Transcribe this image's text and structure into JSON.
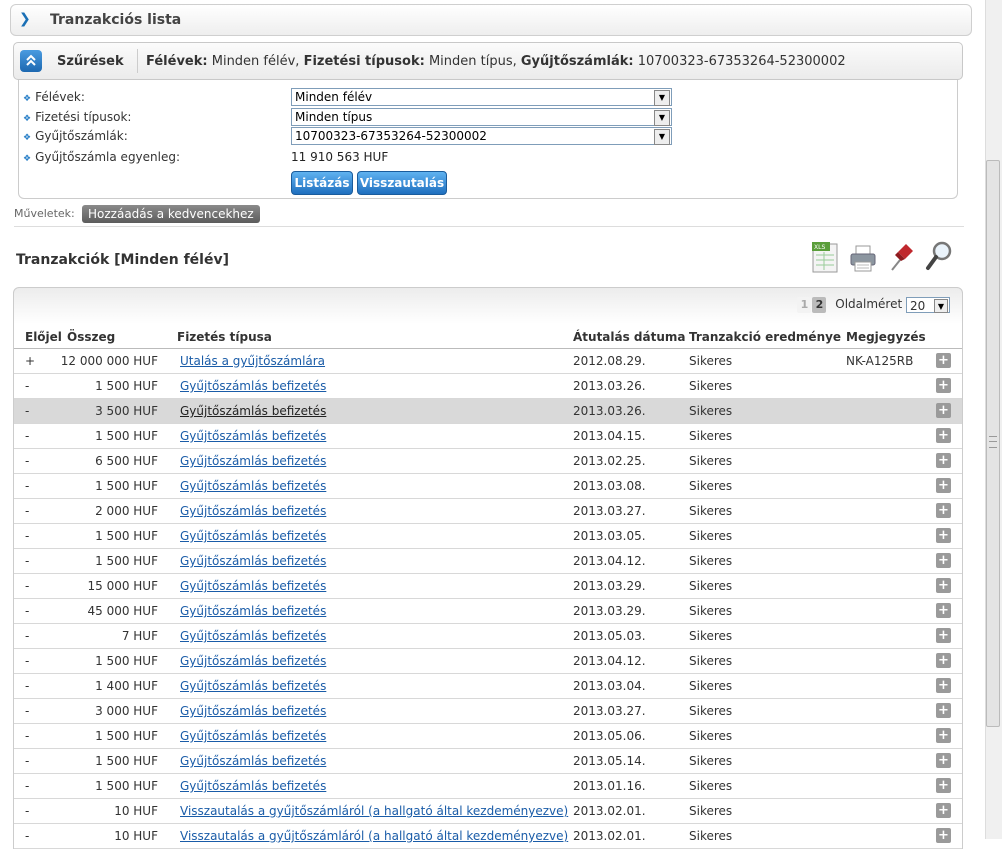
{
  "page_title": "Tranzakciós lista",
  "filters": {
    "toggle_label": "Szűrések",
    "summary": [
      {
        "key": "Félévek:",
        "value": "Minden félév,"
      },
      {
        "key": "Fizetési típusok:",
        "value": "Minden típus,"
      },
      {
        "key": "Gyűjtőszámlák:",
        "value": "10700323-67353264-52300002"
      }
    ],
    "fields": {
      "semesters_label": "Félévek:",
      "semesters_value": "Minden félév",
      "payment_types_label": "Fizetési típusok:",
      "payment_types_value": "Minden típus",
      "accounts_label": "Gyűjtőszámlák:",
      "accounts_value": "10700323-67353264-52300002",
      "balance_label": "Gyűjtőszámla egyenleg:",
      "balance_value": "11 910 563 HUF"
    },
    "list_button": "Listázás",
    "refund_button": "Visszautalás"
  },
  "operations": {
    "label": "Műveletek:",
    "add_favorite": "Hozzáadás a kedvencekhez"
  },
  "section_title": "Tranzakciók [Minden félév]",
  "toolbar_icons": [
    "excel-export-icon",
    "print-icon",
    "pin-icon",
    "search-icon"
  ],
  "pager": {
    "pages": [
      "1",
      "2"
    ],
    "current_page": "2",
    "page_size_label": "Oldalméret",
    "page_size": "20"
  },
  "table": {
    "columns": [
      "Előjel",
      "Összeg",
      "Fizetés típusa",
      "Átutalás dátuma",
      "Tranzakció eredménye",
      "Megjegyzés"
    ],
    "rows": [
      {
        "sign": "+",
        "amount": "12 000 000 HUF",
        "type": "Utalás a gyűjtőszámlára",
        "date": "2012.08.29.",
        "result": "Sikeres",
        "note": "NK-A125RB"
      },
      {
        "sign": "-",
        "amount": "1 500 HUF",
        "type": "Gyűjtőszámlás befizetés",
        "date": "2013.03.26.",
        "result": "Sikeres",
        "note": ""
      },
      {
        "sign": "-",
        "amount": "3 500 HUF",
        "type": "Gyűjtőszámlás befizetés",
        "date": "2013.03.26.",
        "result": "Sikeres",
        "note": "",
        "highlighted": true
      },
      {
        "sign": "-",
        "amount": "1 500 HUF",
        "type": "Gyűjtőszámlás befizetés",
        "date": "2013.04.15.",
        "result": "Sikeres",
        "note": ""
      },
      {
        "sign": "-",
        "amount": "6 500 HUF",
        "type": "Gyűjtőszámlás befizetés",
        "date": "2013.02.25.",
        "result": "Sikeres",
        "note": ""
      },
      {
        "sign": "-",
        "amount": "1 500 HUF",
        "type": "Gyűjtőszámlás befizetés",
        "date": "2013.03.08.",
        "result": "Sikeres",
        "note": ""
      },
      {
        "sign": "-",
        "amount": "2 000 HUF",
        "type": "Gyűjtőszámlás befizetés",
        "date": "2013.03.27.",
        "result": "Sikeres",
        "note": ""
      },
      {
        "sign": "-",
        "amount": "1 500 HUF",
        "type": "Gyűjtőszámlás befizetés",
        "date": "2013.03.05.",
        "result": "Sikeres",
        "note": ""
      },
      {
        "sign": "-",
        "amount": "1 500 HUF",
        "type": "Gyűjtőszámlás befizetés",
        "date": "2013.04.12.",
        "result": "Sikeres",
        "note": ""
      },
      {
        "sign": "-",
        "amount": "15 000 HUF",
        "type": "Gyűjtőszámlás befizetés",
        "date": "2013.03.29.",
        "result": "Sikeres",
        "note": ""
      },
      {
        "sign": "-",
        "amount": "45 000 HUF",
        "type": "Gyűjtőszámlás befizetés",
        "date": "2013.03.29.",
        "result": "Sikeres",
        "note": ""
      },
      {
        "sign": "-",
        "amount": "7 HUF",
        "type": "Gyűjtőszámlás befizetés",
        "date": "2013.05.03.",
        "result": "Sikeres",
        "note": ""
      },
      {
        "sign": "-",
        "amount": "1 500 HUF",
        "type": "Gyűjtőszámlás befizetés",
        "date": "2013.04.12.",
        "result": "Sikeres",
        "note": ""
      },
      {
        "sign": "-",
        "amount": "1 400 HUF",
        "type": "Gyűjtőszámlás befizetés",
        "date": "2013.03.04.",
        "result": "Sikeres",
        "note": ""
      },
      {
        "sign": "-",
        "amount": "3 000 HUF",
        "type": "Gyűjtőszámlás befizetés",
        "date": "2013.03.27.",
        "result": "Sikeres",
        "note": ""
      },
      {
        "sign": "-",
        "amount": "1 500 HUF",
        "type": "Gyűjtőszámlás befizetés",
        "date": "2013.05.06.",
        "result": "Sikeres",
        "note": ""
      },
      {
        "sign": "-",
        "amount": "1 500 HUF",
        "type": "Gyűjtőszámlás befizetés",
        "date": "2013.05.14.",
        "result": "Sikeres",
        "note": ""
      },
      {
        "sign": "-",
        "amount": "1 500 HUF",
        "type": "Gyűjtőszámlás befizetés",
        "date": "2013.01.16.",
        "result": "Sikeres",
        "note": ""
      },
      {
        "sign": "-",
        "amount": "10 HUF",
        "type": "Visszautalás a gyűjtőszámláról (a hallgató által kezdeményezve)",
        "date": "2013.02.01.",
        "result": "Sikeres",
        "note": ""
      },
      {
        "sign": "-",
        "amount": "10 HUF",
        "type": "Visszautalás a gyűjtőszámláról (a hallgató által kezdeményezve)",
        "date": "2013.02.01.",
        "result": "Sikeres",
        "note": ""
      }
    ]
  },
  "colors": {
    "accent": "#1f6fbf",
    "link": "#1a5ca8",
    "highlight_row": "#d9d9d9"
  }
}
